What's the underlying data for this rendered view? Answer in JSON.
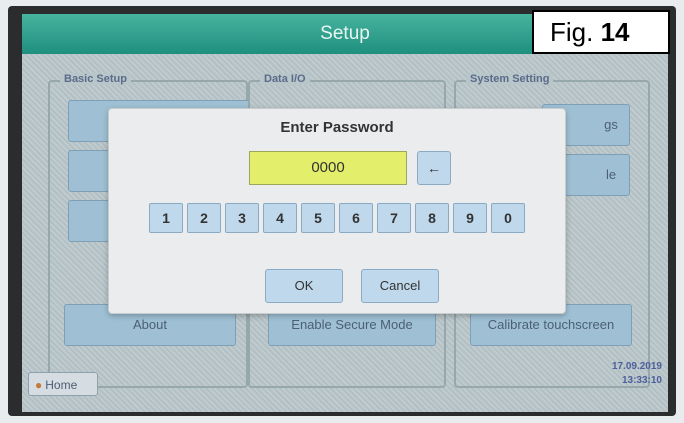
{
  "window": {
    "title": "Setup"
  },
  "groups": {
    "basic": {
      "label": "Basic Setup",
      "buttons": [
        "About"
      ]
    },
    "data_io": {
      "label": "Data I/O",
      "buttons": [
        "Enable Secure Mode"
      ]
    },
    "system": {
      "label": "System Setting",
      "buttons": [
        "Calibrate touchscreen"
      ],
      "partial_labels": [
        "gs",
        "le"
      ]
    }
  },
  "footer": {
    "home_label": "Home",
    "date": "17.09.2019",
    "time": "13:33:10"
  },
  "dialog": {
    "title": "Enter Password",
    "password_value": "0000",
    "backspace_glyph": "←",
    "keys": [
      "1",
      "2",
      "3",
      "4",
      "5",
      "6",
      "7",
      "8",
      "9",
      "0"
    ],
    "ok_label": "OK",
    "cancel_label": "Cancel"
  },
  "figure": {
    "prefix": "Fig.",
    "number": "14"
  },
  "colors": {
    "title_bar": "#2aa08a",
    "password_field": "#e3ee6a",
    "button": "#bfd8eb",
    "background_button": "#9fc0d4"
  }
}
